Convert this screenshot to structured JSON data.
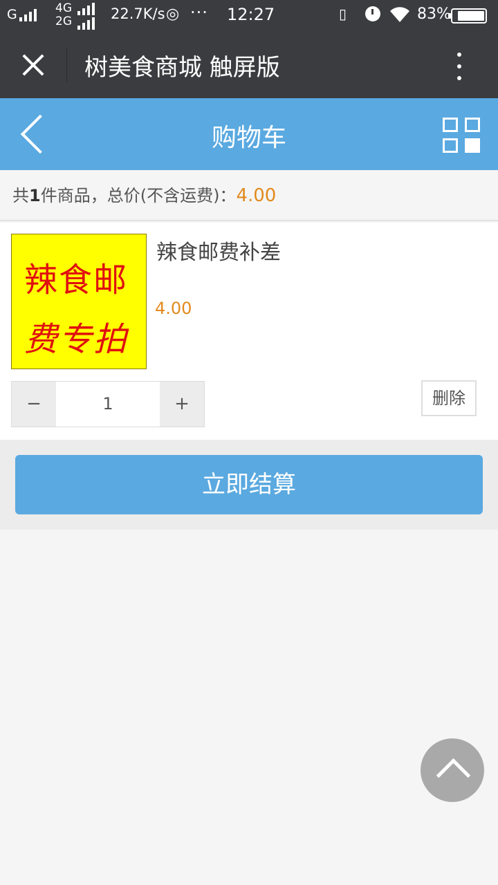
{
  "status_bar": {
    "signal_carrier": "G",
    "network_top": "4G",
    "network_bottom": "2G",
    "speed": "22.7K/s",
    "overflow": "···",
    "time": "12:27",
    "vibrate": "▯",
    "battery_percent": "83%",
    "battery_level": 0.83
  },
  "title_bar": {
    "title": "树美食商城 触屏版"
  },
  "header": {
    "title": "购物车"
  },
  "summary": {
    "prefix": "共",
    "count": "1",
    "middle": "件商品，总价(不含运费)：",
    "total": "4.00"
  },
  "cart_item": {
    "image_lines": [
      "辣食邮",
      "费专拍"
    ],
    "name": "辣食邮费补差",
    "price": "4.00",
    "quantity": "1",
    "minus_label": "−",
    "plus_label": "+",
    "delete_label": "删除"
  },
  "checkout": {
    "label": "立即结算"
  },
  "colors": {
    "accent": "#5aa9e0",
    "price": "#e28a1e",
    "dark_bar": "#3a3c3f"
  },
  "icons": {
    "close": "close-icon",
    "more": "more-vertical-icon",
    "back": "chevron-left-icon",
    "grid": "grid-icon",
    "scroll_top": "chevron-up-icon"
  }
}
